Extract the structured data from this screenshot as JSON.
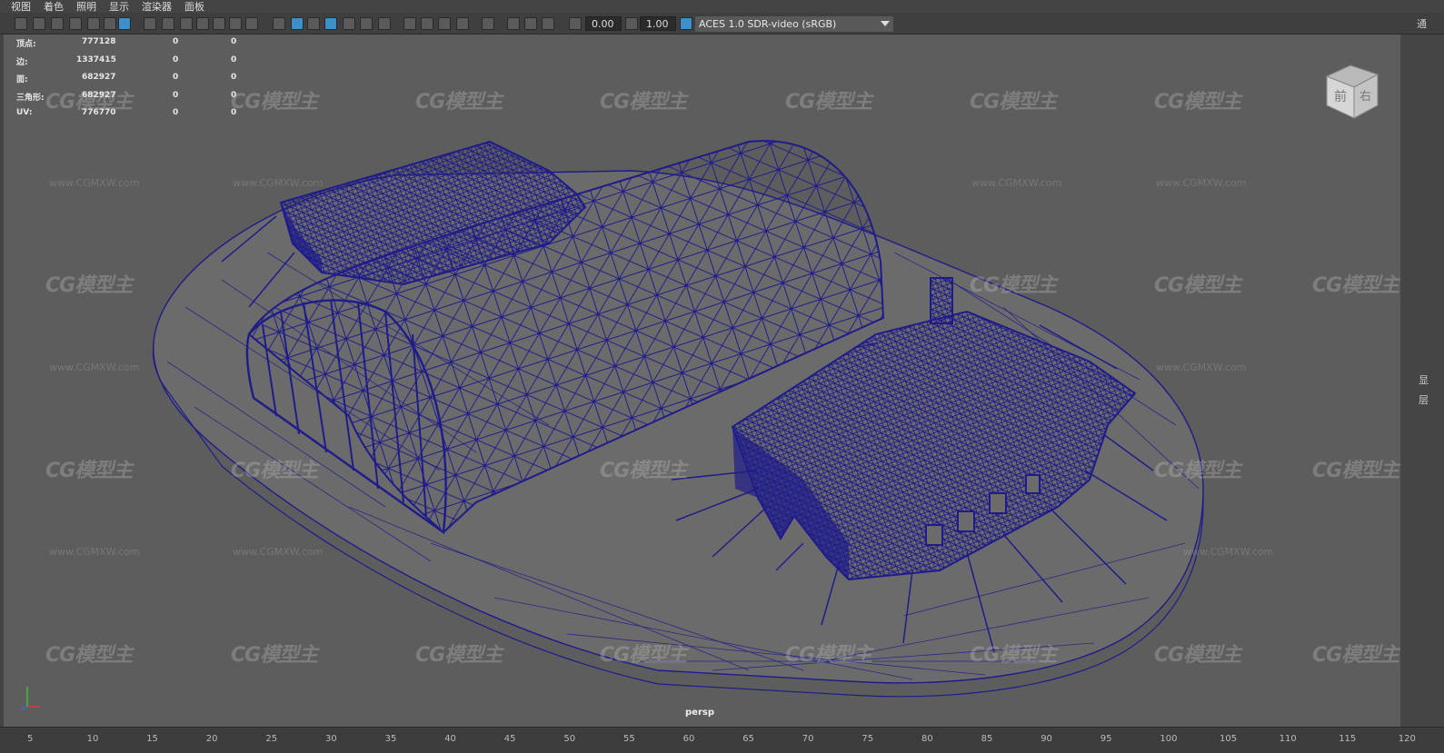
{
  "menu": [
    "视图",
    "着色",
    "照明",
    "显示",
    "渲染器",
    "面板"
  ],
  "toolbar": {
    "exposure_value": "0.00",
    "gamma_value": "1.00",
    "color_space": "ACES 1.0 SDR-video (sRGB)"
  },
  "hud": [
    {
      "label": "顶点:",
      "value": "777128",
      "c2": "0",
      "c3": "0"
    },
    {
      "label": "边:",
      "value": "1337415",
      "c2": "0",
      "c3": "0"
    },
    {
      "label": "面:",
      "value": "682927",
      "c2": "0",
      "c3": "0"
    },
    {
      "label": "三角形:",
      "value": "682927",
      "c2": "0",
      "c3": "0"
    },
    {
      "label": "UV:",
      "value": "776770",
      "c2": "0",
      "c3": "0"
    }
  ],
  "viewcube": {
    "front": "前",
    "right": "右"
  },
  "camera_label": "persp",
  "watermark": {
    "logo": "CG模型主",
    "url": "www.CGMXW.com"
  },
  "timeline_ticks": [
    "5",
    "10",
    "15",
    "20",
    "25",
    "30",
    "35",
    "40",
    "45",
    "50",
    "55",
    "60",
    "65",
    "70",
    "75",
    "80",
    "85",
    "90",
    "95",
    "100",
    "105",
    "110",
    "115",
    "120"
  ],
  "right_panel_glyphs": [
    "通",
    "显",
    "层"
  ],
  "colors": {
    "wire": "#1f1c8a",
    "viewport_bg": "#5d5d5d",
    "ground": "#6b6b6b"
  }
}
